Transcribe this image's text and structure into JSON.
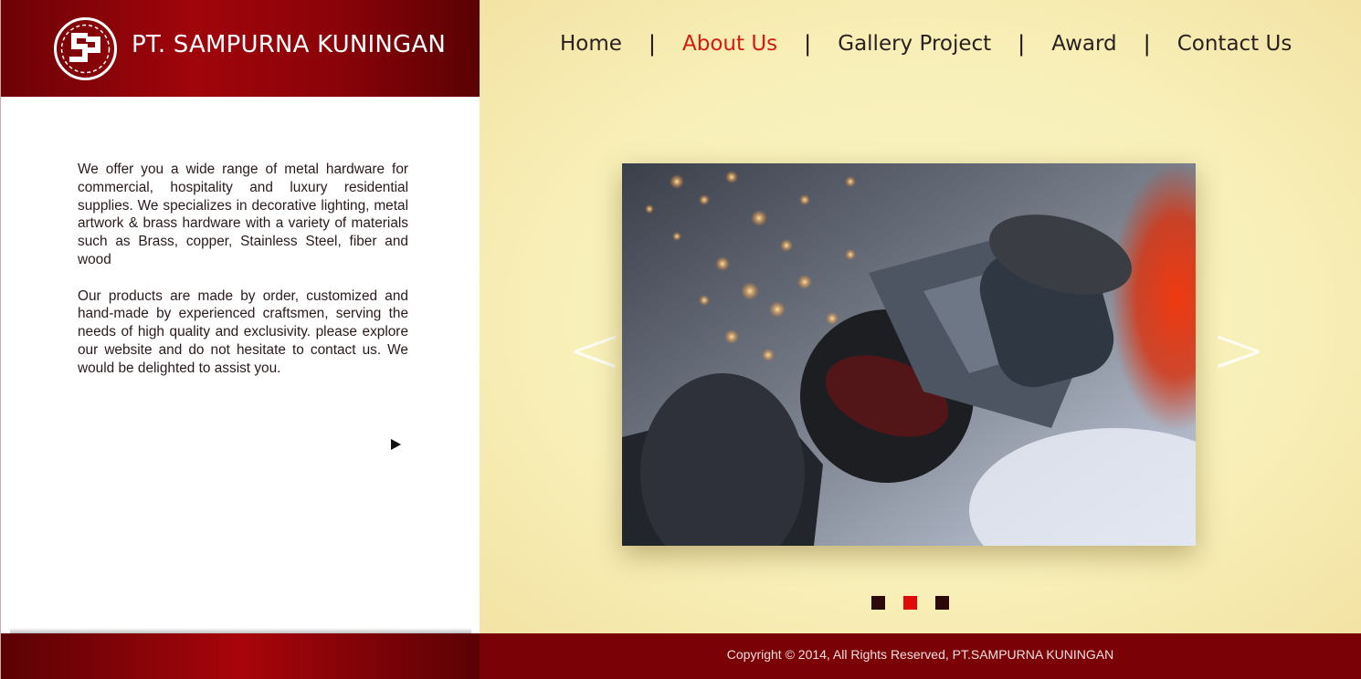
{
  "brand": {
    "name": "PT. SAMPURNA KUNINGAN",
    "logo_icon": "sp-monogram-logo"
  },
  "nav": {
    "items": [
      {
        "label": "Home",
        "active": false
      },
      {
        "label": "About Us",
        "active": true
      },
      {
        "label": "Gallery Project",
        "active": false
      },
      {
        "label": "Award",
        "active": false
      },
      {
        "label": "Contact Us",
        "active": false
      }
    ],
    "separator": "|"
  },
  "intro": {
    "paragraphs": [
      "We offer you a wide range of metal hardware for commercial, hospitality and luxury residential supplies. We specializes in decorative lighting, metal artwork & brass hardware with a variety of materials such as Brass, copper, Stainless Steel, fiber and wood",
      "Our products are made by order, customized and hand-made by experienced craftsmen, serving the needs of high quality and exclusivity. please explore our website and do not hesitate to contact us. We would be delighted to assist you."
    ],
    "more_icon": "play-triangle-icon"
  },
  "slider": {
    "prev_label": "<",
    "next_label": ">",
    "image_subject": "angle-grinder-sparks-photo",
    "slide_count": 3,
    "active_index": 1
  },
  "footer": {
    "copyright": "Copyright © 2014, All Rights Reserved, PT.SAMPURNA KUNINGAN"
  },
  "colors": {
    "brand_red": "#8a0308",
    "accent_red": "#d61a10",
    "panel_yellow": "#f8efb8"
  }
}
